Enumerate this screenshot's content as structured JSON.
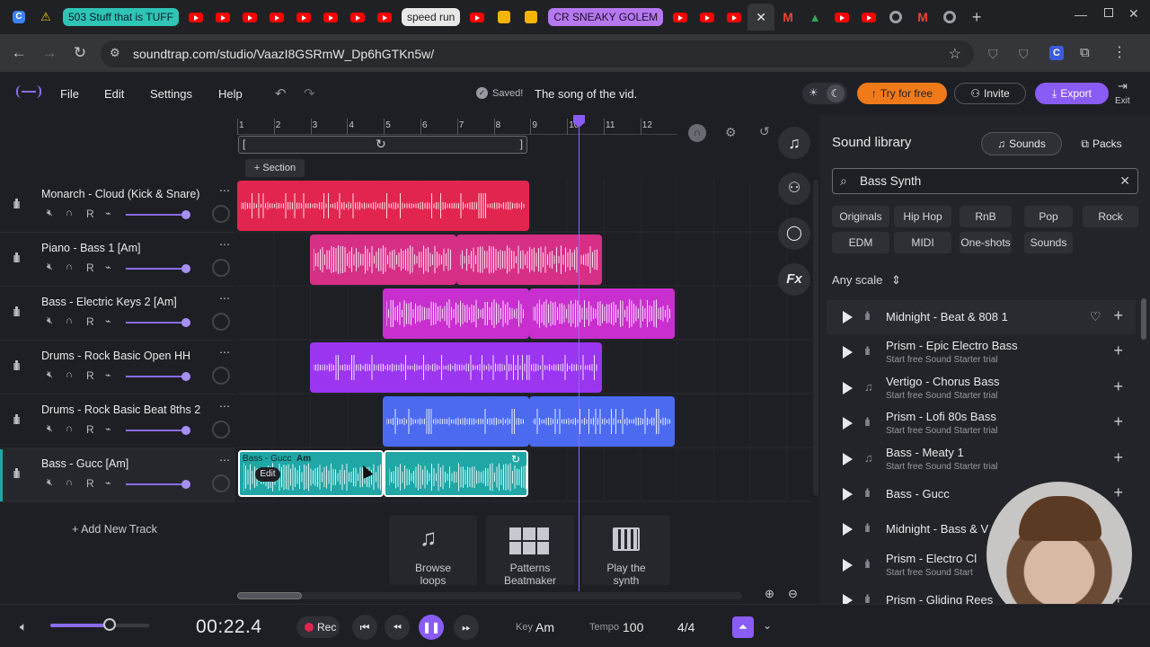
{
  "browser": {
    "tabs": [
      {
        "type": "pill",
        "label": "503 Stuff that is TUFF",
        "color": "#2ec4b6",
        "text_color": "#0d1b2a"
      },
      {
        "type": "pill",
        "label": "speed run",
        "color": "#e8e8e8",
        "text_color": "#202124"
      },
      {
        "type": "pill",
        "label": "CR SNEAKY GOLEM",
        "color": "#b678f0",
        "text_color": "#1a1024"
      }
    ],
    "url": "soundtrap.com/studio/VaazI8GSRmW_Dp6hGTKn5w/"
  },
  "app": {
    "menu": [
      "File",
      "Edit",
      "Settings",
      "Help"
    ],
    "saved_label": "Saved!",
    "song_title": "The song of the vid.",
    "try_label": "Try for free",
    "invite_label": "Invite",
    "export_label": "Export",
    "exit_label": "Exit",
    "section_label": "+ Section",
    "ruler": [
      "1",
      "2",
      "3",
      "4",
      "5",
      "6",
      "7",
      "8",
      "9",
      "10",
      "11",
      "12"
    ],
    "add_track_label": "+ Add New Track",
    "colors": {
      "accent": "#8a5cf6",
      "orange": "#f07a1a"
    }
  },
  "tracks": [
    {
      "name": "Monarch - Cloud (Kick & Snare)",
      "clip_color": "#e2254f"
    },
    {
      "name": "Piano - Bass 1 [Am]",
      "clip_color": "#d72f86"
    },
    {
      "name": "Bass - Electric Keys 2 [Am]",
      "clip_color": "#c82fce"
    },
    {
      "name": "Drums - Rock Basic Open HH",
      "clip_color": "#9b35f0"
    },
    {
      "name": "Drums - Rock Basic Beat 8ths 2",
      "clip_color": "#4b6af0"
    },
    {
      "name": "Bass - Gucc [Am]",
      "clip_color": "#1fa6a5"
    }
  ],
  "track_controls": {
    "rec": "R"
  },
  "selected_clip": {
    "title": "Bass - Gucc",
    "key": "Am",
    "edit_label": "Edit"
  },
  "bottom_actions": [
    {
      "label": "Browse loops",
      "icon": "music-note-icon"
    },
    {
      "label": "Patterns Beatmaker",
      "icon": "grid-icon"
    },
    {
      "label": "Play the synth",
      "icon": "piano-icon"
    }
  ],
  "library": {
    "title": "Sound library",
    "tabs": [
      "Sounds",
      "Packs"
    ],
    "search_value": "Bass Synth",
    "tags": [
      "Originals",
      "Hip Hop",
      "RnB",
      "Pop",
      "Rock",
      "EDM",
      "MIDI",
      "One-shots",
      "Sounds"
    ],
    "scale_label": "Any scale",
    "items": [
      {
        "title": "Midnight - Beat & 808 1",
        "sub": ""
      },
      {
        "title": "Prism - Epic Electro Bass",
        "sub": "Start free Sound Starter trial"
      },
      {
        "title": "Vertigo - Chorus Bass",
        "sub": "Start free Sound Starter trial"
      },
      {
        "title": "Prism - Lofi 80s Bass",
        "sub": "Start free Sound Starter trial"
      },
      {
        "title": "Bass - Meaty 1",
        "sub": "Start free Sound Starter trial"
      },
      {
        "title": "Bass - Gucc",
        "sub": ""
      },
      {
        "title": "Midnight - Bass & V",
        "sub": ""
      },
      {
        "title": "Prism - Electro Cl",
        "sub": "Start free Sound Start"
      },
      {
        "title": "Prism - Gliding Rees",
        "sub": ""
      }
    ]
  },
  "transport": {
    "time": "00:22.4",
    "rec_label": "Rec",
    "key_label": "Key",
    "key_value": "Am",
    "tempo_label": "Tempo",
    "tempo_value": "100",
    "signature": "4/4",
    "volume": 0.6
  }
}
